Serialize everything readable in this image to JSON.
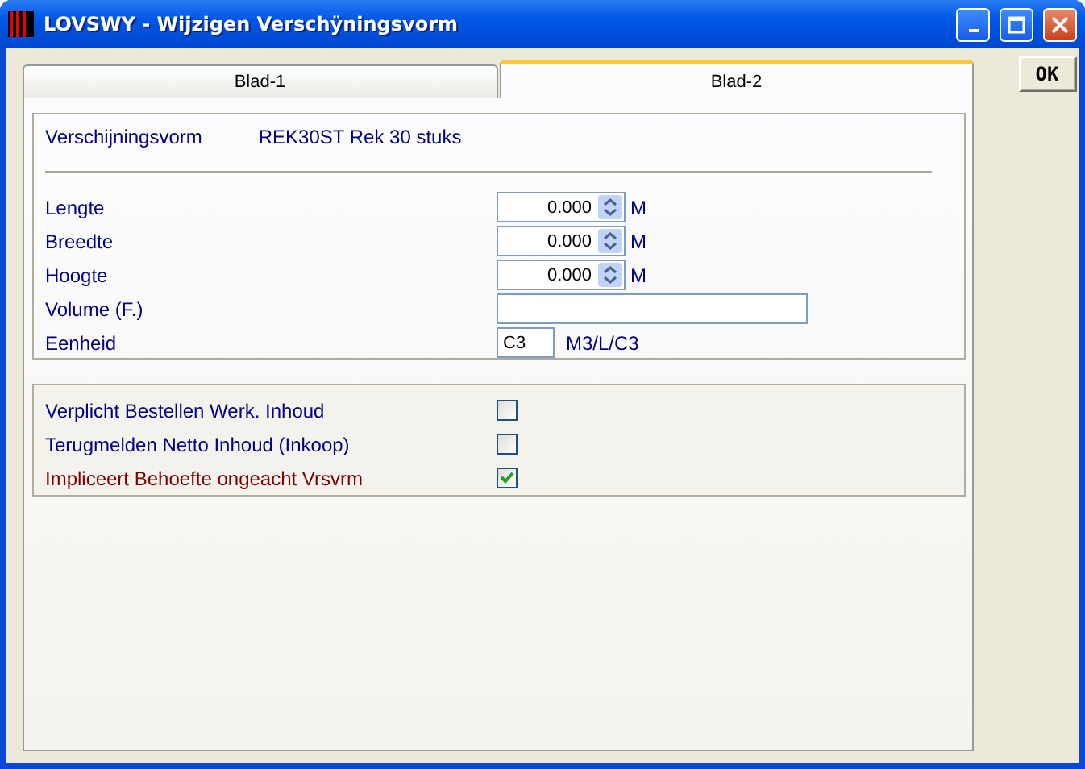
{
  "window": {
    "title": "LOVSWY - Wijzigen Verschÿningsvorm"
  },
  "tabs": [
    {
      "label": "Blad-1",
      "selected": false
    },
    {
      "label": "Blad-2",
      "selected": true
    }
  ],
  "ok_button": "OK",
  "header": {
    "label": "Verschijningsvorm",
    "value": "REK30ST Rek 30 stuks"
  },
  "fields": [
    {
      "kind": "spin",
      "label": "Lengte",
      "value": "0.000",
      "unit": "M"
    },
    {
      "kind": "spin",
      "label": "Breedte",
      "value": "0.000",
      "unit": "M"
    },
    {
      "kind": "spin",
      "label": "Hoogte",
      "value": "0.000",
      "unit": "M"
    },
    {
      "kind": "text",
      "label": "Volume (F.)"
    },
    {
      "kind": "short",
      "label": "Eenheid",
      "value": "C3",
      "unit": "M3/L/C3"
    }
  ],
  "checkboxes": [
    {
      "label": "Verplicht Bestellen Werk. Inhoud",
      "checked": false,
      "color": "#000080"
    },
    {
      "label": "Terugmelden Netto Inhoud (Inkoop)",
      "checked": false,
      "color": "#000080"
    },
    {
      "label": "Impliceert Behoefte ongeacht Vrsvrm",
      "checked": true,
      "color": "#800000"
    }
  ]
}
